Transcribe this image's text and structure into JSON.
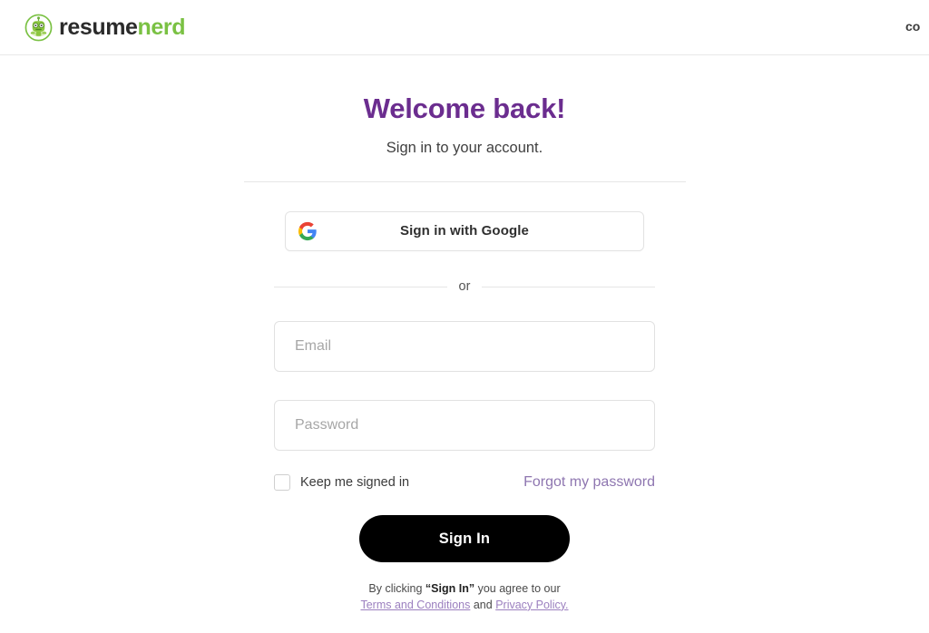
{
  "header": {
    "logo": {
      "icon_name": "resumenerd-robot-icon",
      "word_primary": "resume",
      "word_accent": "nerd",
      "primary_color": "#2b2b2b",
      "accent_color": "#7ac143"
    },
    "nav": [
      {
        "label": "co",
        "name": "nav-item-truncated"
      }
    ]
  },
  "main": {
    "title": "Welcome back!",
    "title_color": "#6b2d8f",
    "subtitle": "Sign in to your account.",
    "google_button": {
      "label": "Sign in with Google",
      "icon_name": "google-g-icon"
    },
    "divider_text": "or",
    "fields": {
      "email": {
        "placeholder": "Email",
        "value": ""
      },
      "password": {
        "placeholder": "Password",
        "value": ""
      }
    },
    "keep_signed_in": {
      "label": "Keep me signed in",
      "checked": false
    },
    "forgot_link": {
      "label": "Forgot my password",
      "color": "#8e76b0"
    },
    "submit_button": {
      "label": "Sign In",
      "background": "#000000",
      "text_color": "#ffffff"
    },
    "legal": {
      "prefix": "By clicking ",
      "emphasis": "“Sign In”",
      "middle": " you agree to our",
      "terms_link": "Terms and Conditions",
      "conjunction": " and ",
      "privacy_link": "Privacy Policy.",
      "link_color": "#9b7fbf"
    }
  }
}
